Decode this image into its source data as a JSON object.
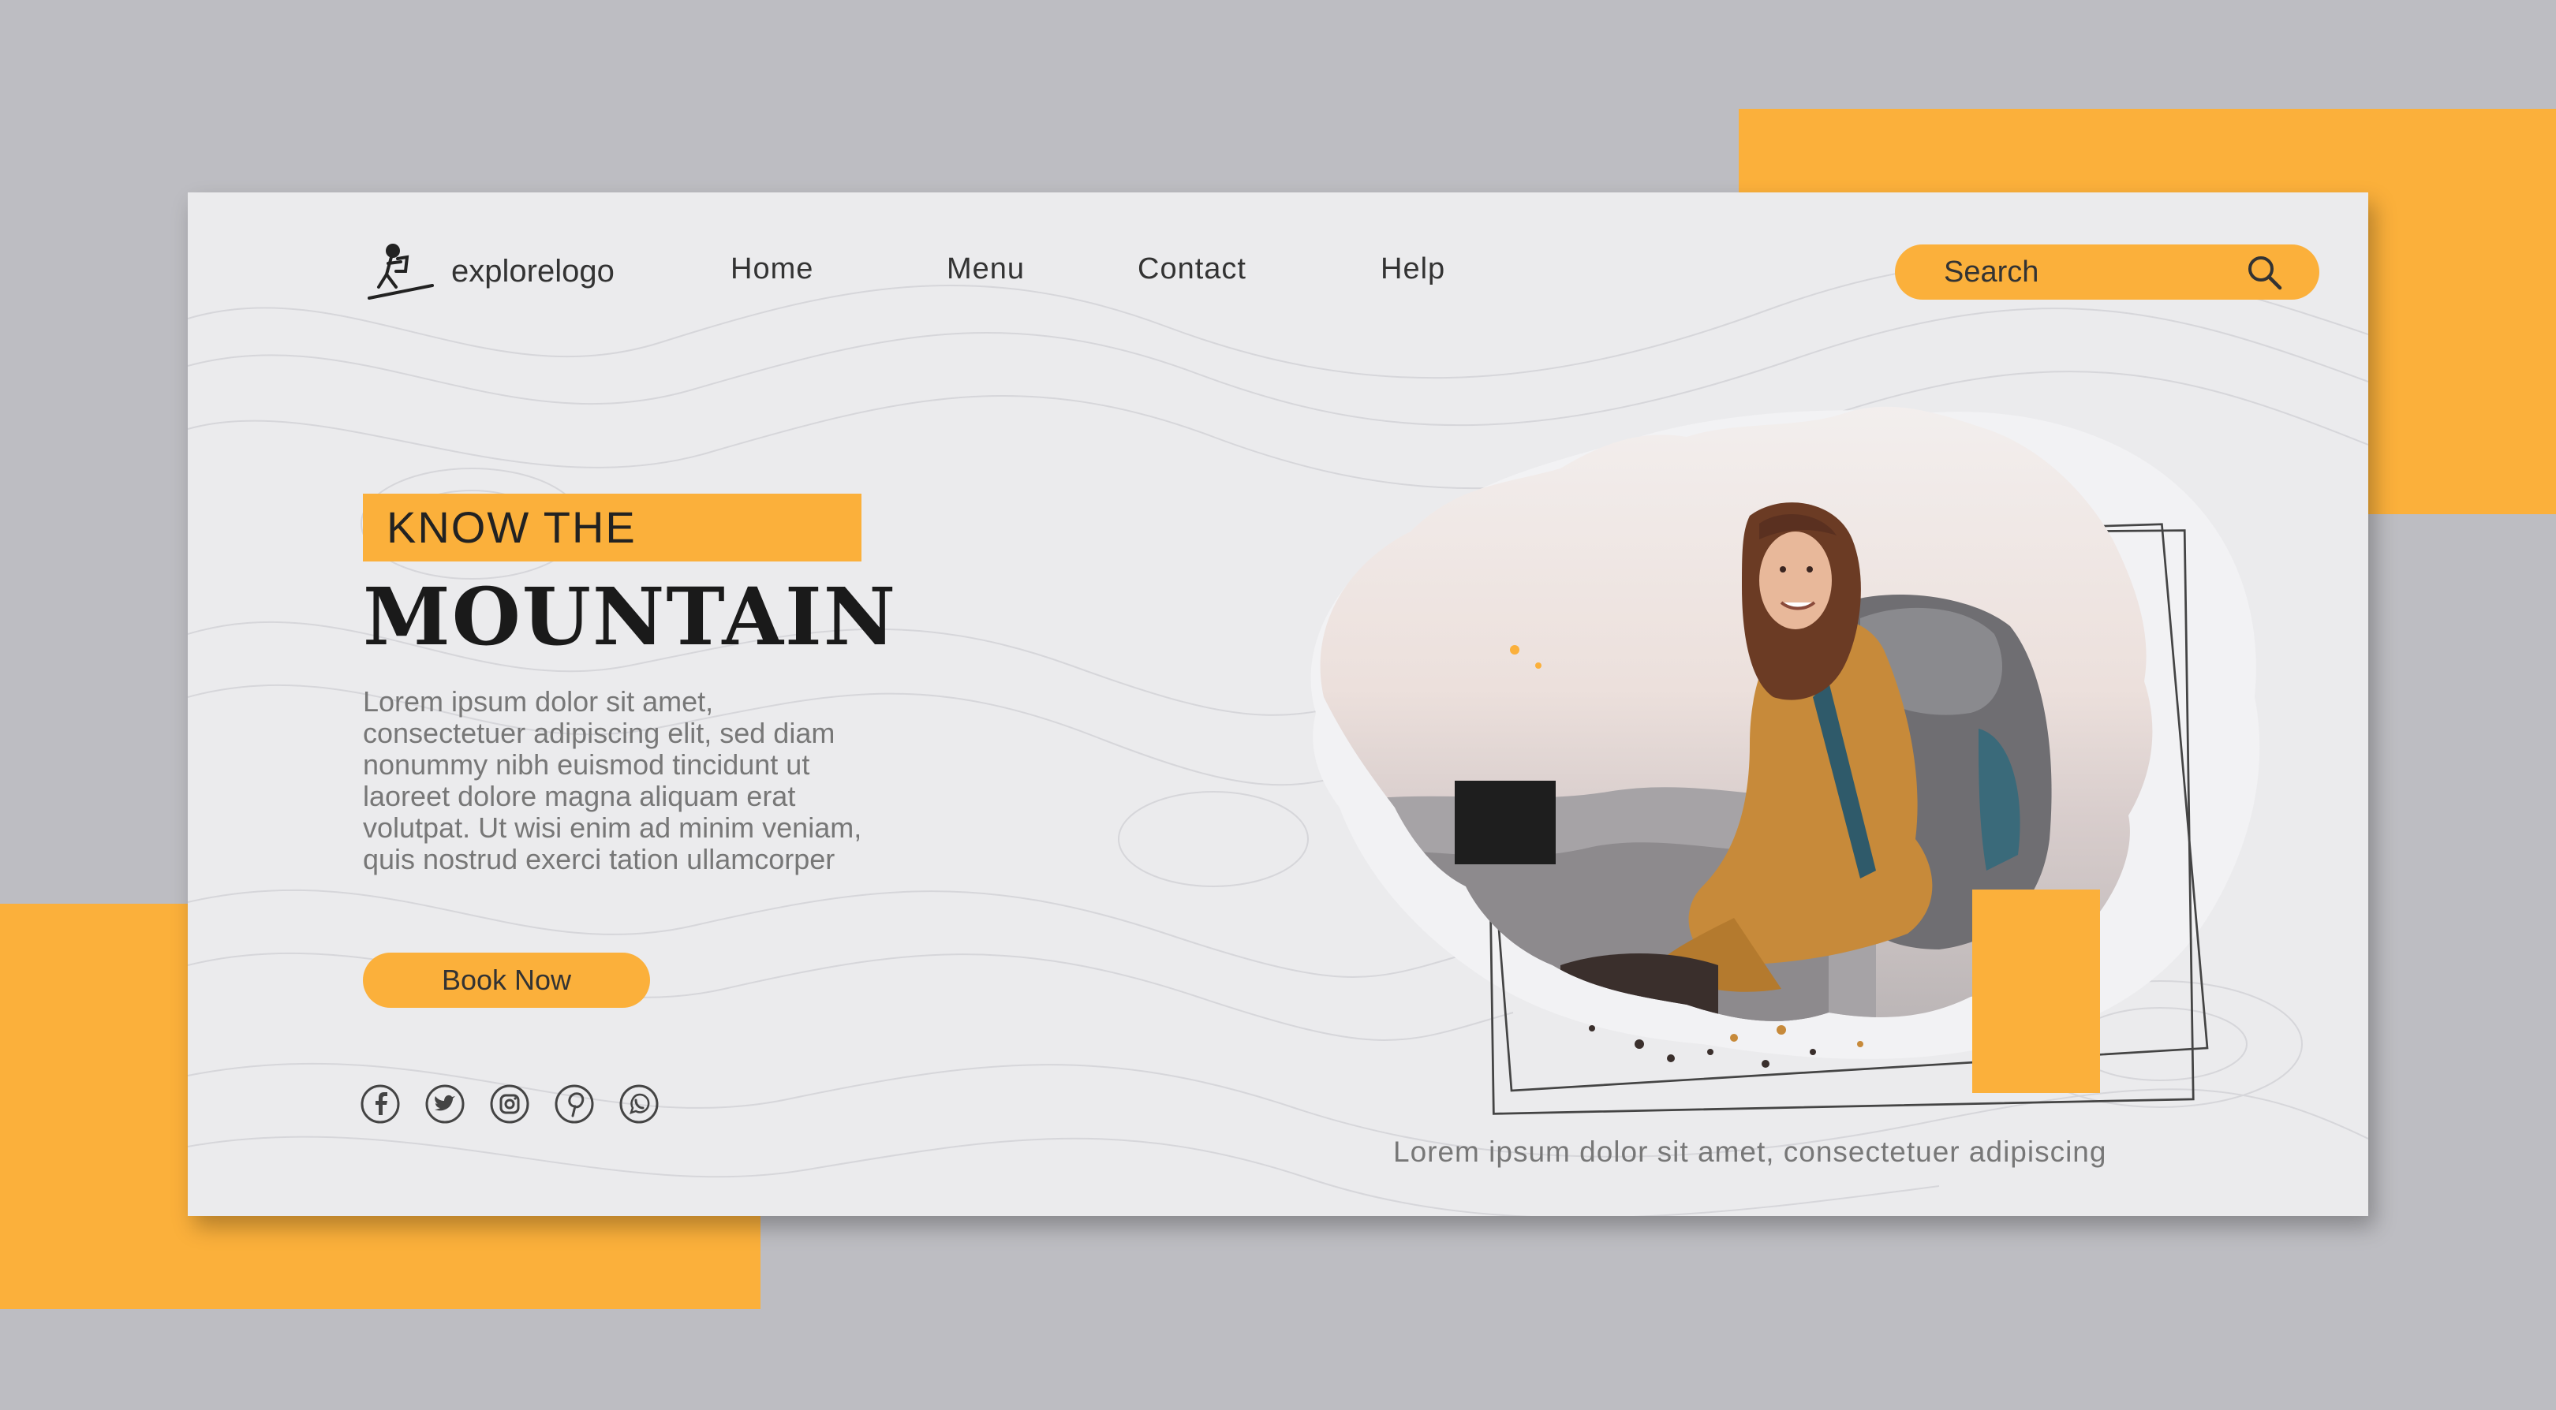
{
  "nav": {
    "logo_text": "explorelogo",
    "links": [
      "Home",
      "Menu",
      "Contact",
      "Help"
    ],
    "search_placeholder": "Search"
  },
  "hero": {
    "kicker": "KNOW THE",
    "headline": "MOUNTAIN",
    "body": "Lorem ipsum dolor sit amet,\nconsectetuer adipiscing elit, sed diam\nnonummy nibh euismod tincidunt ut\nlaoreet dolore magna aliquam erat\nvolutpat. Ut wisi enim ad minim veniam,\nquis nostrud exerci tation ullamcorper",
    "cta": "Book Now"
  },
  "socials": [
    "facebook-icon",
    "twitter-icon",
    "instagram-icon",
    "pinterest-icon",
    "whatsapp-icon"
  ],
  "caption": "Lorem ipsum dolor sit amet, consectetuer adipiscing",
  "colors": {
    "accent": "#fbb03b",
    "background": "#bdbdc2",
    "card": "#ebebed",
    "dark": "#1a1a1a"
  }
}
